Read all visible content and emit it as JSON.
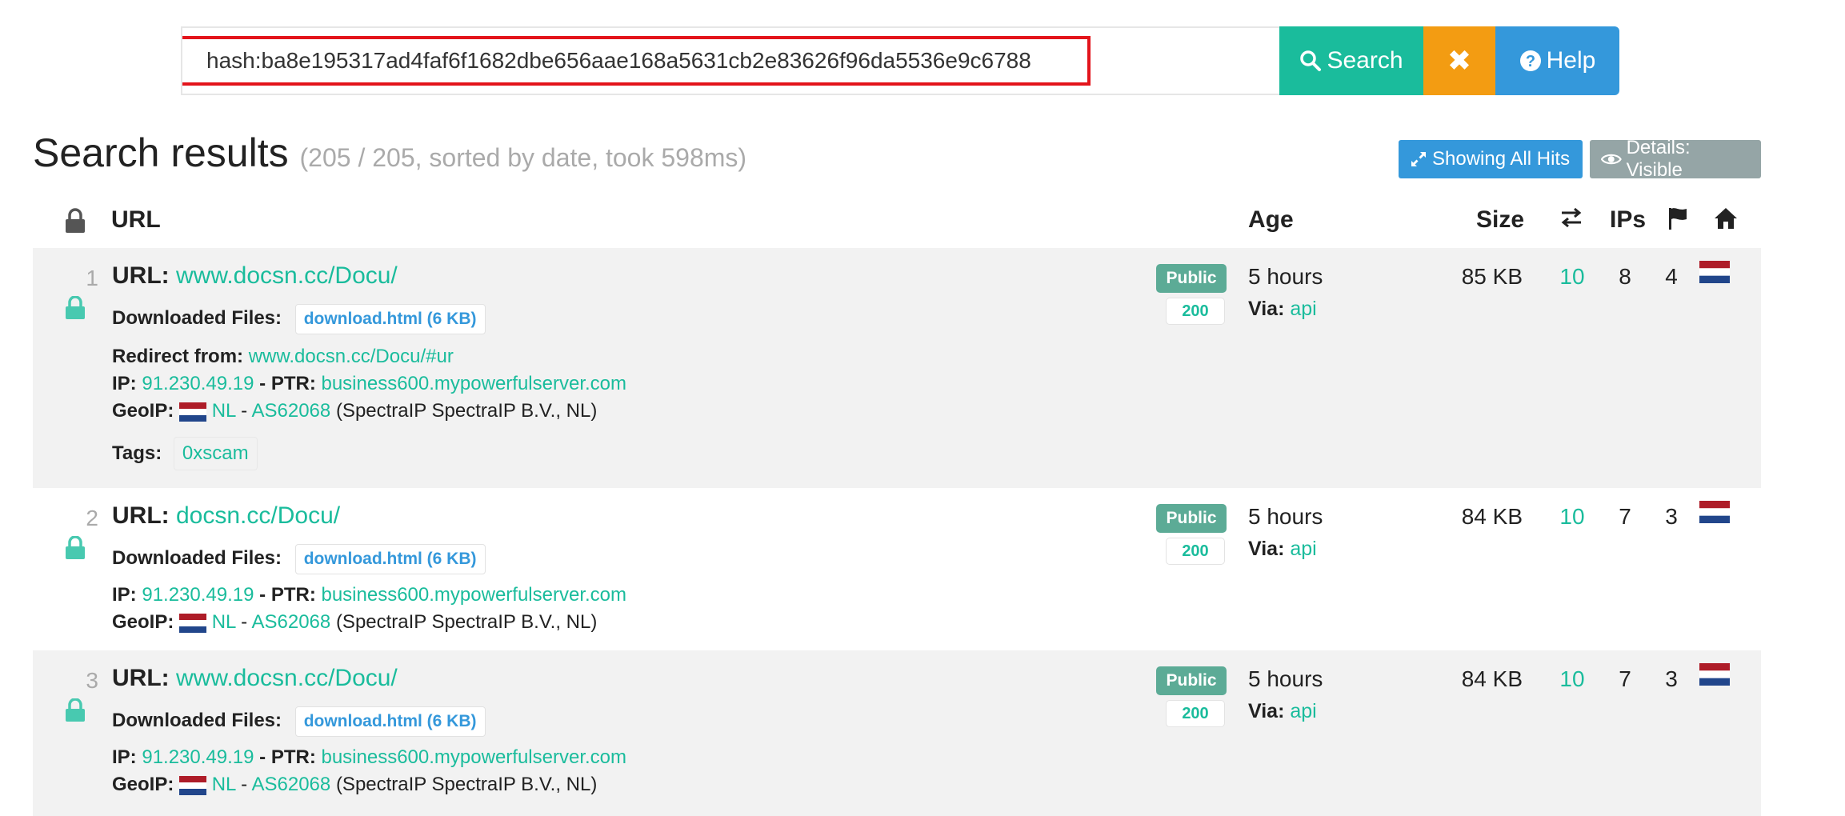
{
  "search": {
    "value": "hash:ba8e195317ad4faf6f1682dbe656aae168a5631cb2e83626f96da5536e9c6788",
    "search_label": "Search",
    "clear_label": "✖",
    "help_label": "Help"
  },
  "header": {
    "title": "Search results",
    "meta": "(205 / 205, sorted by date, took 598ms)",
    "showing_all_hits": "Showing All Hits",
    "details_visible": "Details: Visible"
  },
  "columns": {
    "url": "URL",
    "age": "Age",
    "size": "Size",
    "ips": "IPs"
  },
  "labels": {
    "url": "URL:",
    "downloaded_files": "Downloaded Files:",
    "redirect_from": "Redirect from:",
    "ip": "IP:",
    "ptr": "- PTR:",
    "geoip": "GeoIP:",
    "tags": "Tags:",
    "via": "Via:",
    "dash": "-"
  },
  "rows": [
    {
      "num": "1",
      "url": "www.docsn.cc/Docu/",
      "file": "download.html (6 KB)",
      "redirect": "www.docsn.cc/Docu/#ur",
      "ip": "91.230.49.19",
      "ptr": "business600.mypowerfulserver.com",
      "geo_country": "NL",
      "geo_as": "AS62068",
      "geo_org": "(SpectraIP SpectraIP B.V., NL)",
      "tag": "0xscam",
      "visibility": "Public",
      "status": "200",
      "age": "5 hours",
      "via": "api",
      "size": "85 KB",
      "requests": "10",
      "ips": "8",
      "countries": "4"
    },
    {
      "num": "2",
      "url": "docsn.cc/Docu/",
      "file": "download.html (6 KB)",
      "ip": "91.230.49.19",
      "ptr": "business600.mypowerfulserver.com",
      "geo_country": "NL",
      "geo_as": "AS62068",
      "geo_org": "(SpectraIP SpectraIP B.V., NL)",
      "visibility": "Public",
      "status": "200",
      "age": "5 hours",
      "via": "api",
      "size": "84 KB",
      "requests": "10",
      "ips": "7",
      "countries": "3"
    },
    {
      "num": "3",
      "url": "www.docsn.cc/Docu/",
      "file": "download.html (6 KB)",
      "ip": "91.230.49.19",
      "ptr": "business600.mypowerfulserver.com",
      "geo_country": "NL",
      "geo_as": "AS62068",
      "geo_org": "(SpectraIP SpectraIP B.V., NL)",
      "visibility": "Public",
      "status": "200",
      "age": "5 hours",
      "via": "api",
      "size": "84 KB",
      "requests": "10",
      "ips": "7",
      "countries": "3"
    }
  ],
  "colors": {
    "teal": "#1abc9c",
    "orange": "#f39c12",
    "blue": "#3498db",
    "gray": "#95a5a6",
    "highlight": "#e3141b"
  }
}
